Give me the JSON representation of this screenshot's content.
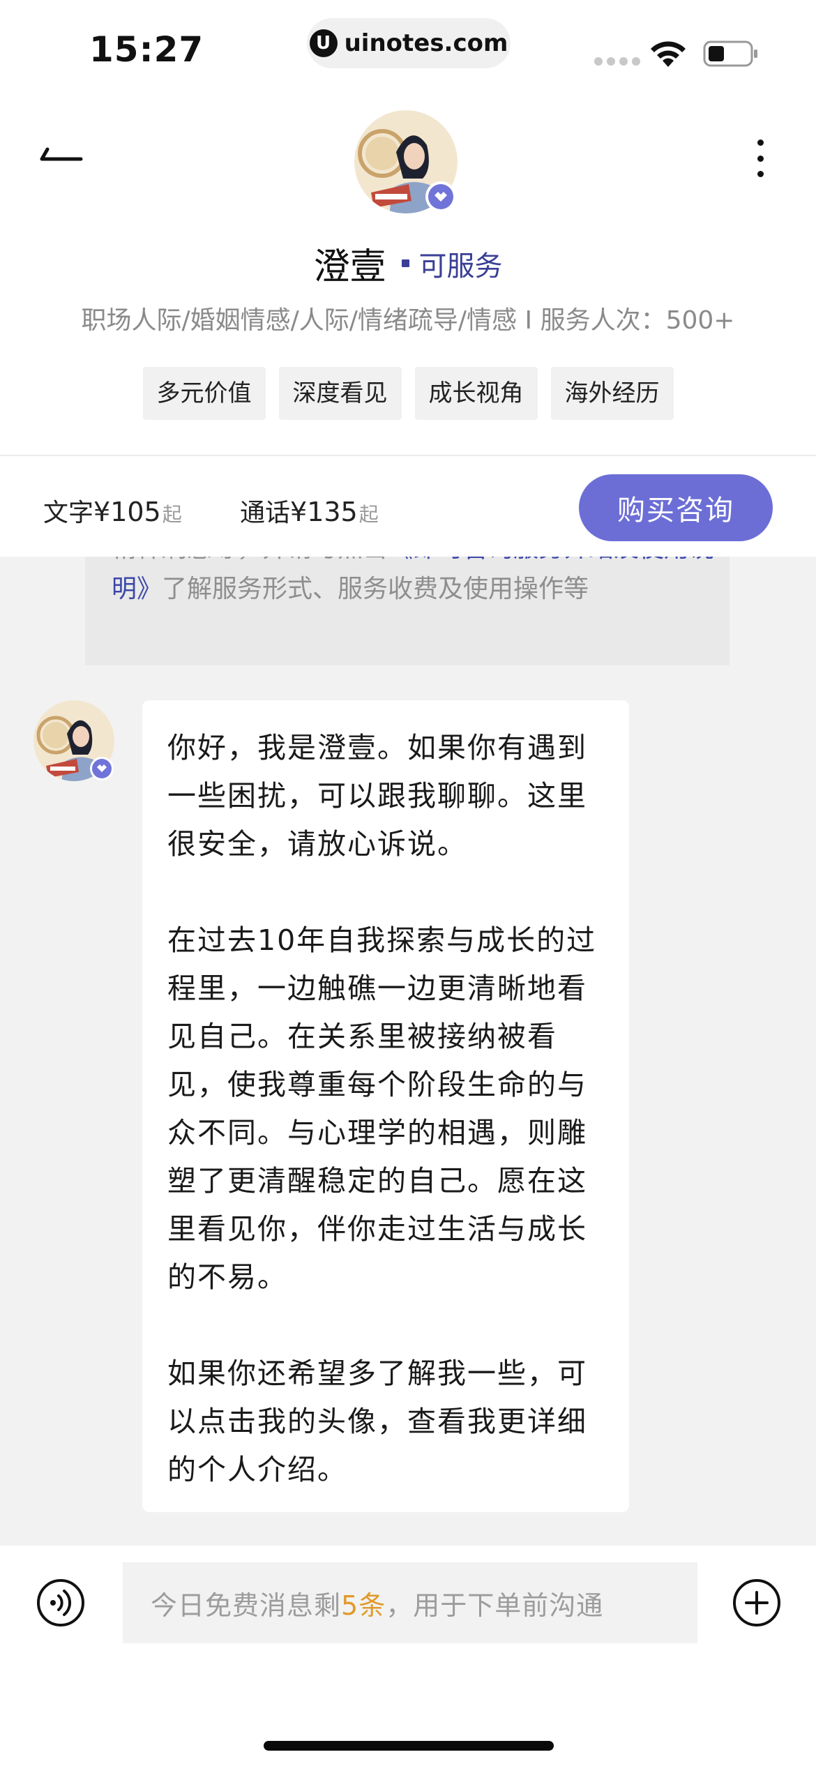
{
  "status_bar": {
    "time": "15:27",
    "url_icon_glyph": "U",
    "url": "uinotes.com"
  },
  "header": {
    "counselor_name": "澄壹",
    "availability": "可服务",
    "service_tags": "职场人际/婚姻情感/人际/情绪疏导/情感 I 服务人次：500+",
    "chips": [
      "多元价值",
      "深度看见",
      "成长视角",
      "海外经历"
    ]
  },
  "price_bar": {
    "text_label": "文字",
    "text_price": "¥105",
    "text_suffix": "起",
    "call_label": "通话",
    "call_price": "¥135",
    "call_suffix": "起",
    "buy_button": "购买咨询"
  },
  "chat": {
    "notice_partial": "精神刷感等，并请与点击",
    "notice_link": "《即时咨询服务介绍及使用说明》",
    "notice_rest": "了解服务形式、服务收费及使用操作等",
    "message": "你好，我是澄壹。如果你有遇到一些困扰，可以跟我聊聊。这里很安全，请放心诉说。\n\n在过去10年自我探索与成长的过程里，一边触礁一边更清晰地看见自己。在关系里被接纳被看见，使我尊重每个阶段生命的与众不同。与心理学的相遇，则雕塑了更清醒稳定的自己。愿在这里看见你，伴你走过生活与成长的不易。\n\n如果你还希望多了解我一些，可以点击我的头像，查看我更详细的个人介绍。"
  },
  "input_bar": {
    "placeholder_prefix": "今日免费消息剩",
    "placeholder_count": "5条",
    "placeholder_suffix": "，用于下单前沟通"
  },
  "colors": {
    "accent_purple": "#6c6ed6",
    "link_blue": "#3c47a8",
    "count_orange": "#e09a2a"
  },
  "icons": [
    "back-arrow-icon",
    "more-vertical-icon",
    "verified-badge-icon",
    "voice-icon",
    "plus-circle-icon",
    "wifi-icon",
    "battery-icon"
  ]
}
